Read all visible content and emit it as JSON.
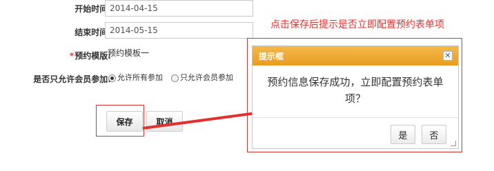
{
  "form": {
    "start_time_label": "开始时间:",
    "start_time_value": "2014-04-15",
    "end_time_label": "结束时间:",
    "end_time_value": "2014-05-15",
    "template_required_mark": "*",
    "template_label": "预约模版:",
    "template_value": "预约模板一",
    "members_only_label": "是否只允许会员参加:",
    "radio_all_label": "允许所有参加",
    "radio_members_label": "只允许会员参加",
    "radio_selected": "all",
    "save_label": "保存",
    "cancel_label": "取消"
  },
  "annotation": {
    "text": "点击保存后提示是否立即配置预约表单项",
    "color": "#e2312d"
  },
  "dialog": {
    "title": "提示框",
    "close_icon": "close-icon",
    "message": "预约信息保存成功，立即配置预约表单项？",
    "yes_label": "是",
    "no_label": "否",
    "header_color": "#eea52c"
  }
}
